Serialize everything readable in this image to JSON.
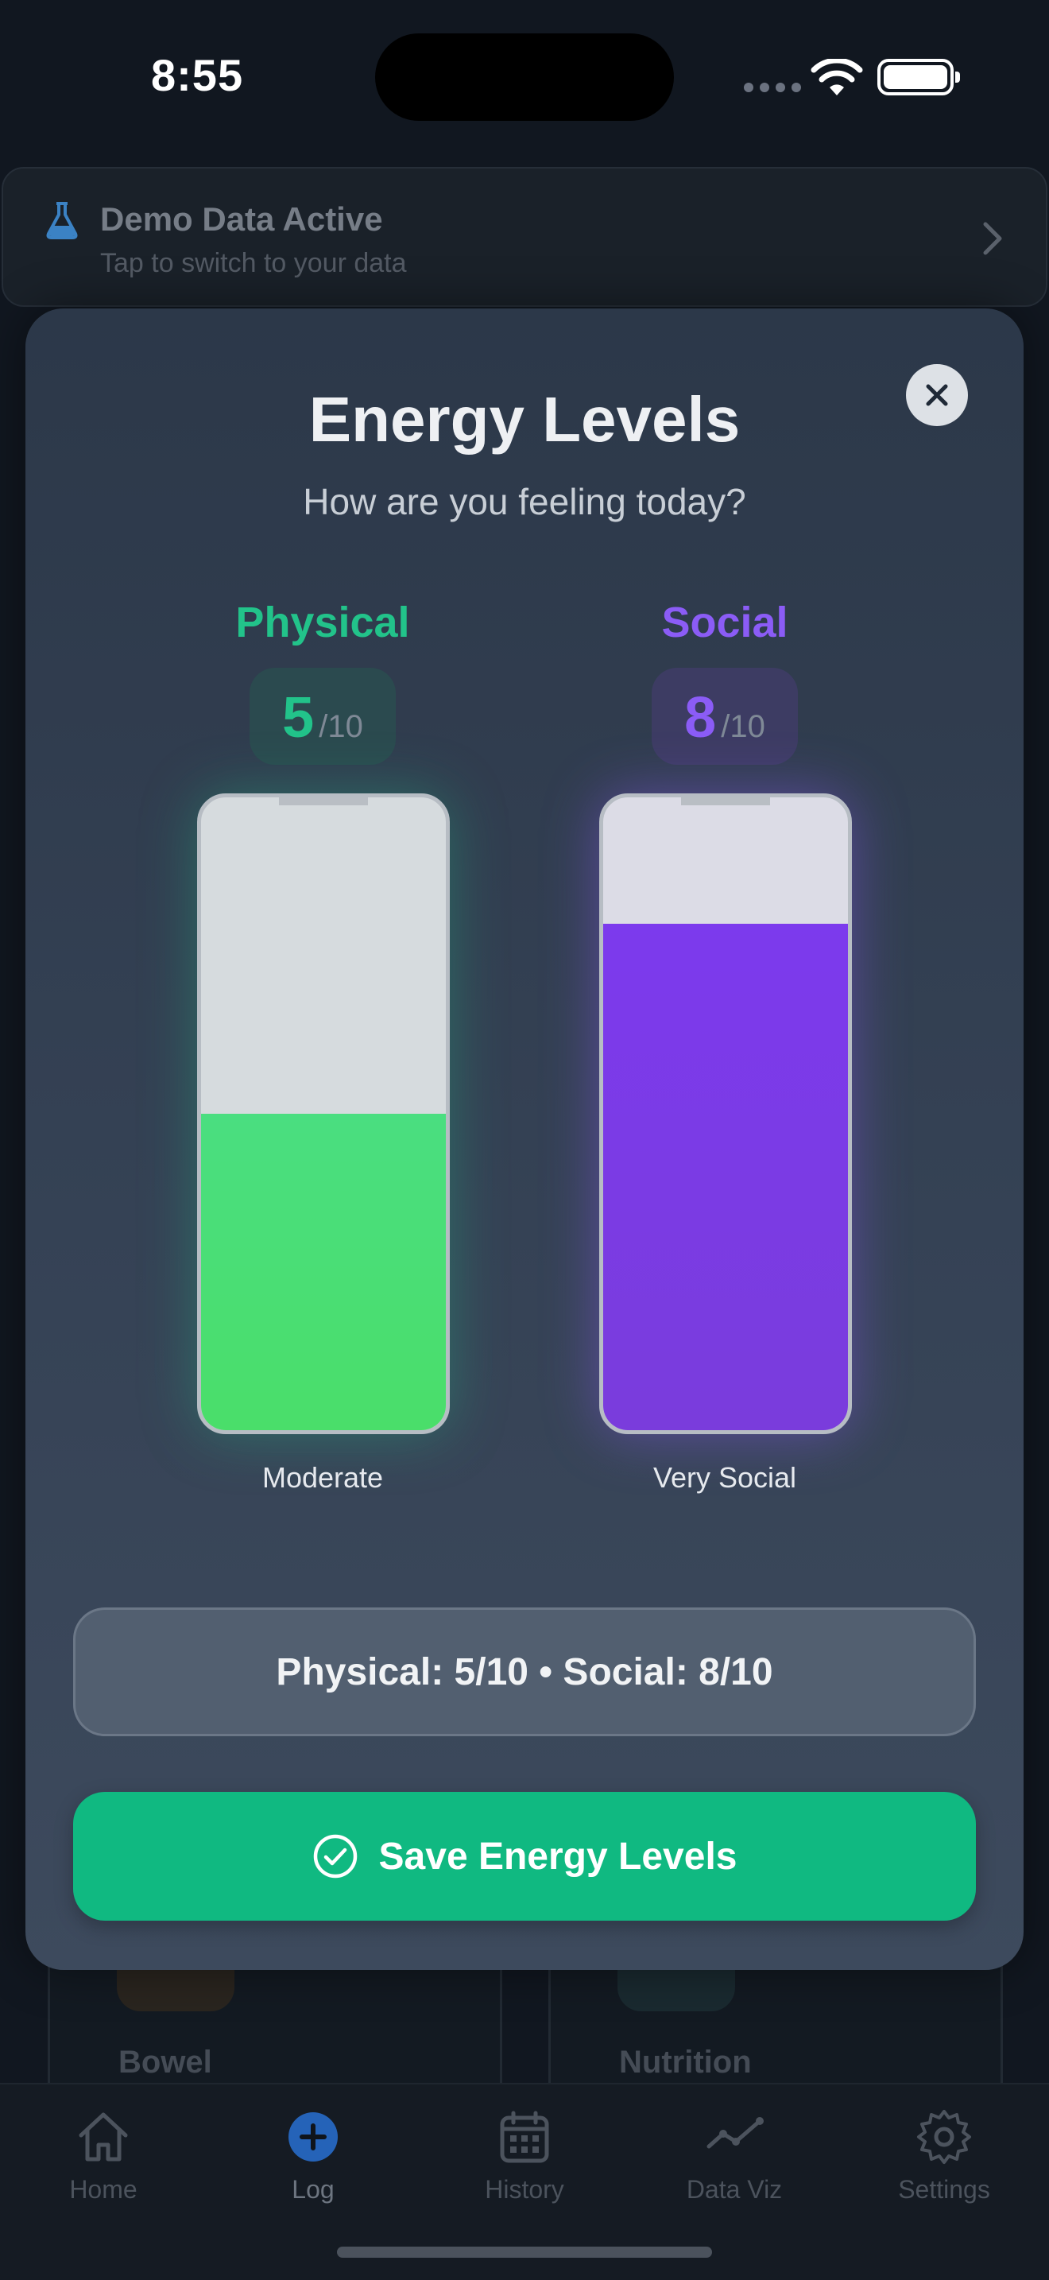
{
  "status_bar": {
    "time": "8:55"
  },
  "demo_banner": {
    "title": "Demo Data Active",
    "subtitle": "Tap to switch to your data"
  },
  "background_tiles": [
    {
      "label": "Bowel",
      "accent": "#3a2f22"
    },
    {
      "label": "Nutrition",
      "accent": "#1d3136"
    }
  ],
  "modal": {
    "title": "Energy Levels",
    "subtitle": "How are you feeling today?",
    "physical": {
      "label": "Physical",
      "value": "5",
      "max": "/10",
      "level_fraction": 0.5,
      "description": "Moderate",
      "color": "#22c38a",
      "fill_color": "#4ade80"
    },
    "social": {
      "label": "Social",
      "value": "8",
      "max": "/10",
      "level_fraction": 0.8,
      "description": "Very Social",
      "color": "#8b5cf6",
      "fill_color": "#7c3aed"
    },
    "summary": "Physical: 5/10 • Social: 8/10",
    "save_label": "Save Energy Levels",
    "save_color": "#10b981"
  },
  "tab_bar": {
    "items": [
      {
        "label": "Home",
        "icon": "home-icon"
      },
      {
        "label": "Log",
        "icon": "plus-circle-icon",
        "active": true
      },
      {
        "label": "History",
        "icon": "calendar-icon"
      },
      {
        "label": "Data Viz",
        "icon": "line-chart-icon"
      },
      {
        "label": "Settings",
        "icon": "gear-icon"
      }
    ]
  }
}
